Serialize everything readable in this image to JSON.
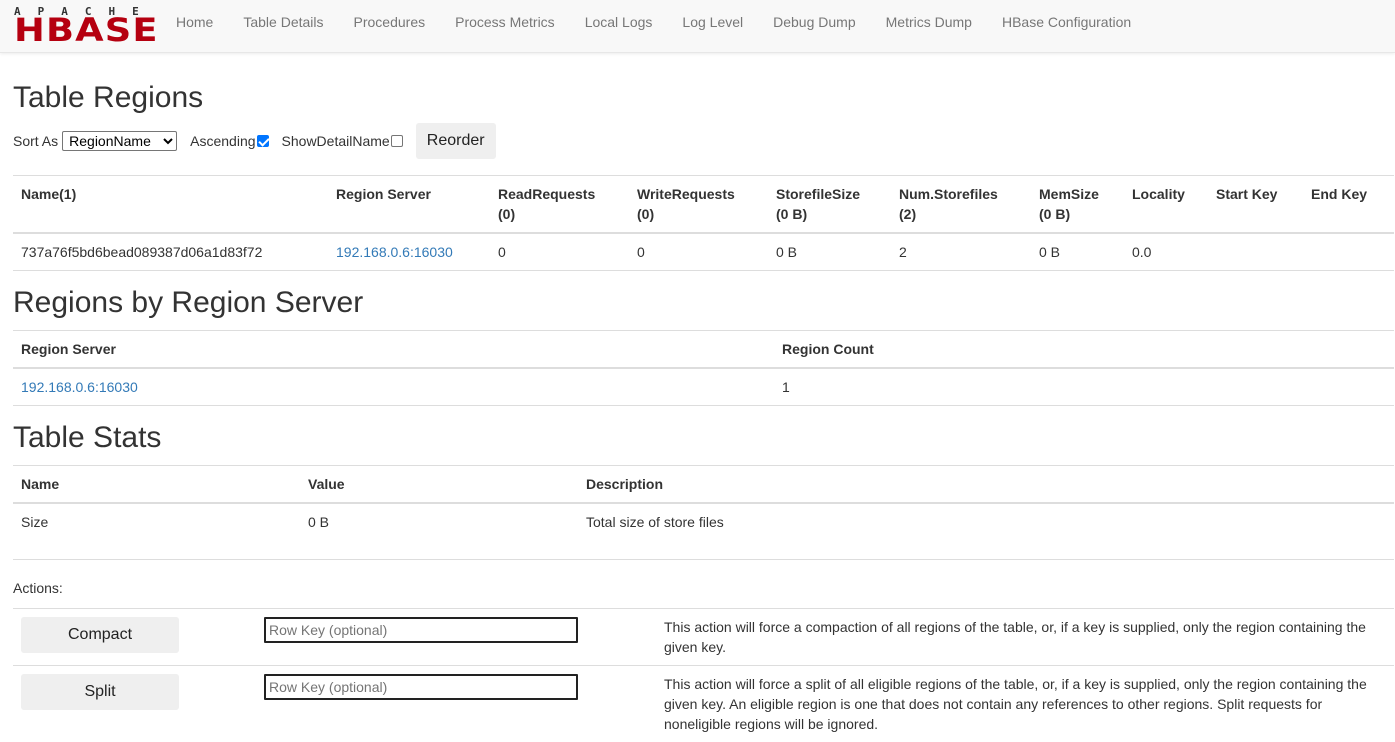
{
  "brand": {
    "top": "APACHE",
    "main": "HBASE",
    "color": "#b50010"
  },
  "nav": [
    "Home",
    "Table Details",
    "Procedures",
    "Process Metrics",
    "Local Logs",
    "Log Level",
    "Debug Dump",
    "Metrics Dump",
    "HBase Configuration"
  ],
  "regions": {
    "title": "Table Regions",
    "sort_label": "Sort As",
    "sort_value": "RegionName",
    "ascending_label": "Ascending",
    "ascending_checked": true,
    "detail_label": "ShowDetailName",
    "detail_checked": false,
    "reorder_label": "Reorder",
    "headers": [
      [
        "Name(1)",
        ""
      ],
      [
        "Region Server",
        ""
      ],
      [
        "ReadRequests",
        "(0)"
      ],
      [
        "WriteRequests",
        "(0)"
      ],
      [
        "StorefileSize",
        "(0 B)"
      ],
      [
        "Num.Storefiles",
        "(2)"
      ],
      [
        "MemSize",
        "(0 B)"
      ],
      [
        "Locality",
        ""
      ],
      [
        "Start Key",
        ""
      ],
      [
        "End Key",
        ""
      ]
    ],
    "row": {
      "name": "737a76f5bd6bead089387d06a1d83f72",
      "server": "192.168.0.6:16030",
      "read": "0",
      "write": "0",
      "storefile_size": "0 B",
      "num_storefiles": "2",
      "memsize": "0 B",
      "locality": "0.0",
      "start_key": "",
      "end_key": ""
    }
  },
  "by_server": {
    "title": "Regions by Region Server",
    "headers": [
      "Region Server",
      "Region Count"
    ],
    "row": {
      "server": "192.168.0.6:16030",
      "count": "1"
    }
  },
  "stats": {
    "title": "Table Stats",
    "headers": [
      "Name",
      "Value",
      "Description"
    ],
    "row": {
      "name": "Size",
      "value": "0 B",
      "description": "Total size of store files"
    }
  },
  "actions": {
    "label": "Actions:",
    "compact": {
      "button": "Compact",
      "placeholder": "Row Key (optional)",
      "description": "This action will force a compaction of all regions of the table, or, if a key is supplied, only the region containing the given key."
    },
    "split": {
      "button": "Split",
      "placeholder": "Row Key (optional)",
      "description": "This action will force a split of all eligible regions of the table, or, if a key is supplied, only the region containing the given key. An eligible region is one that does not contain any references to other regions. Split requests for noneligible regions will be ignored."
    }
  }
}
